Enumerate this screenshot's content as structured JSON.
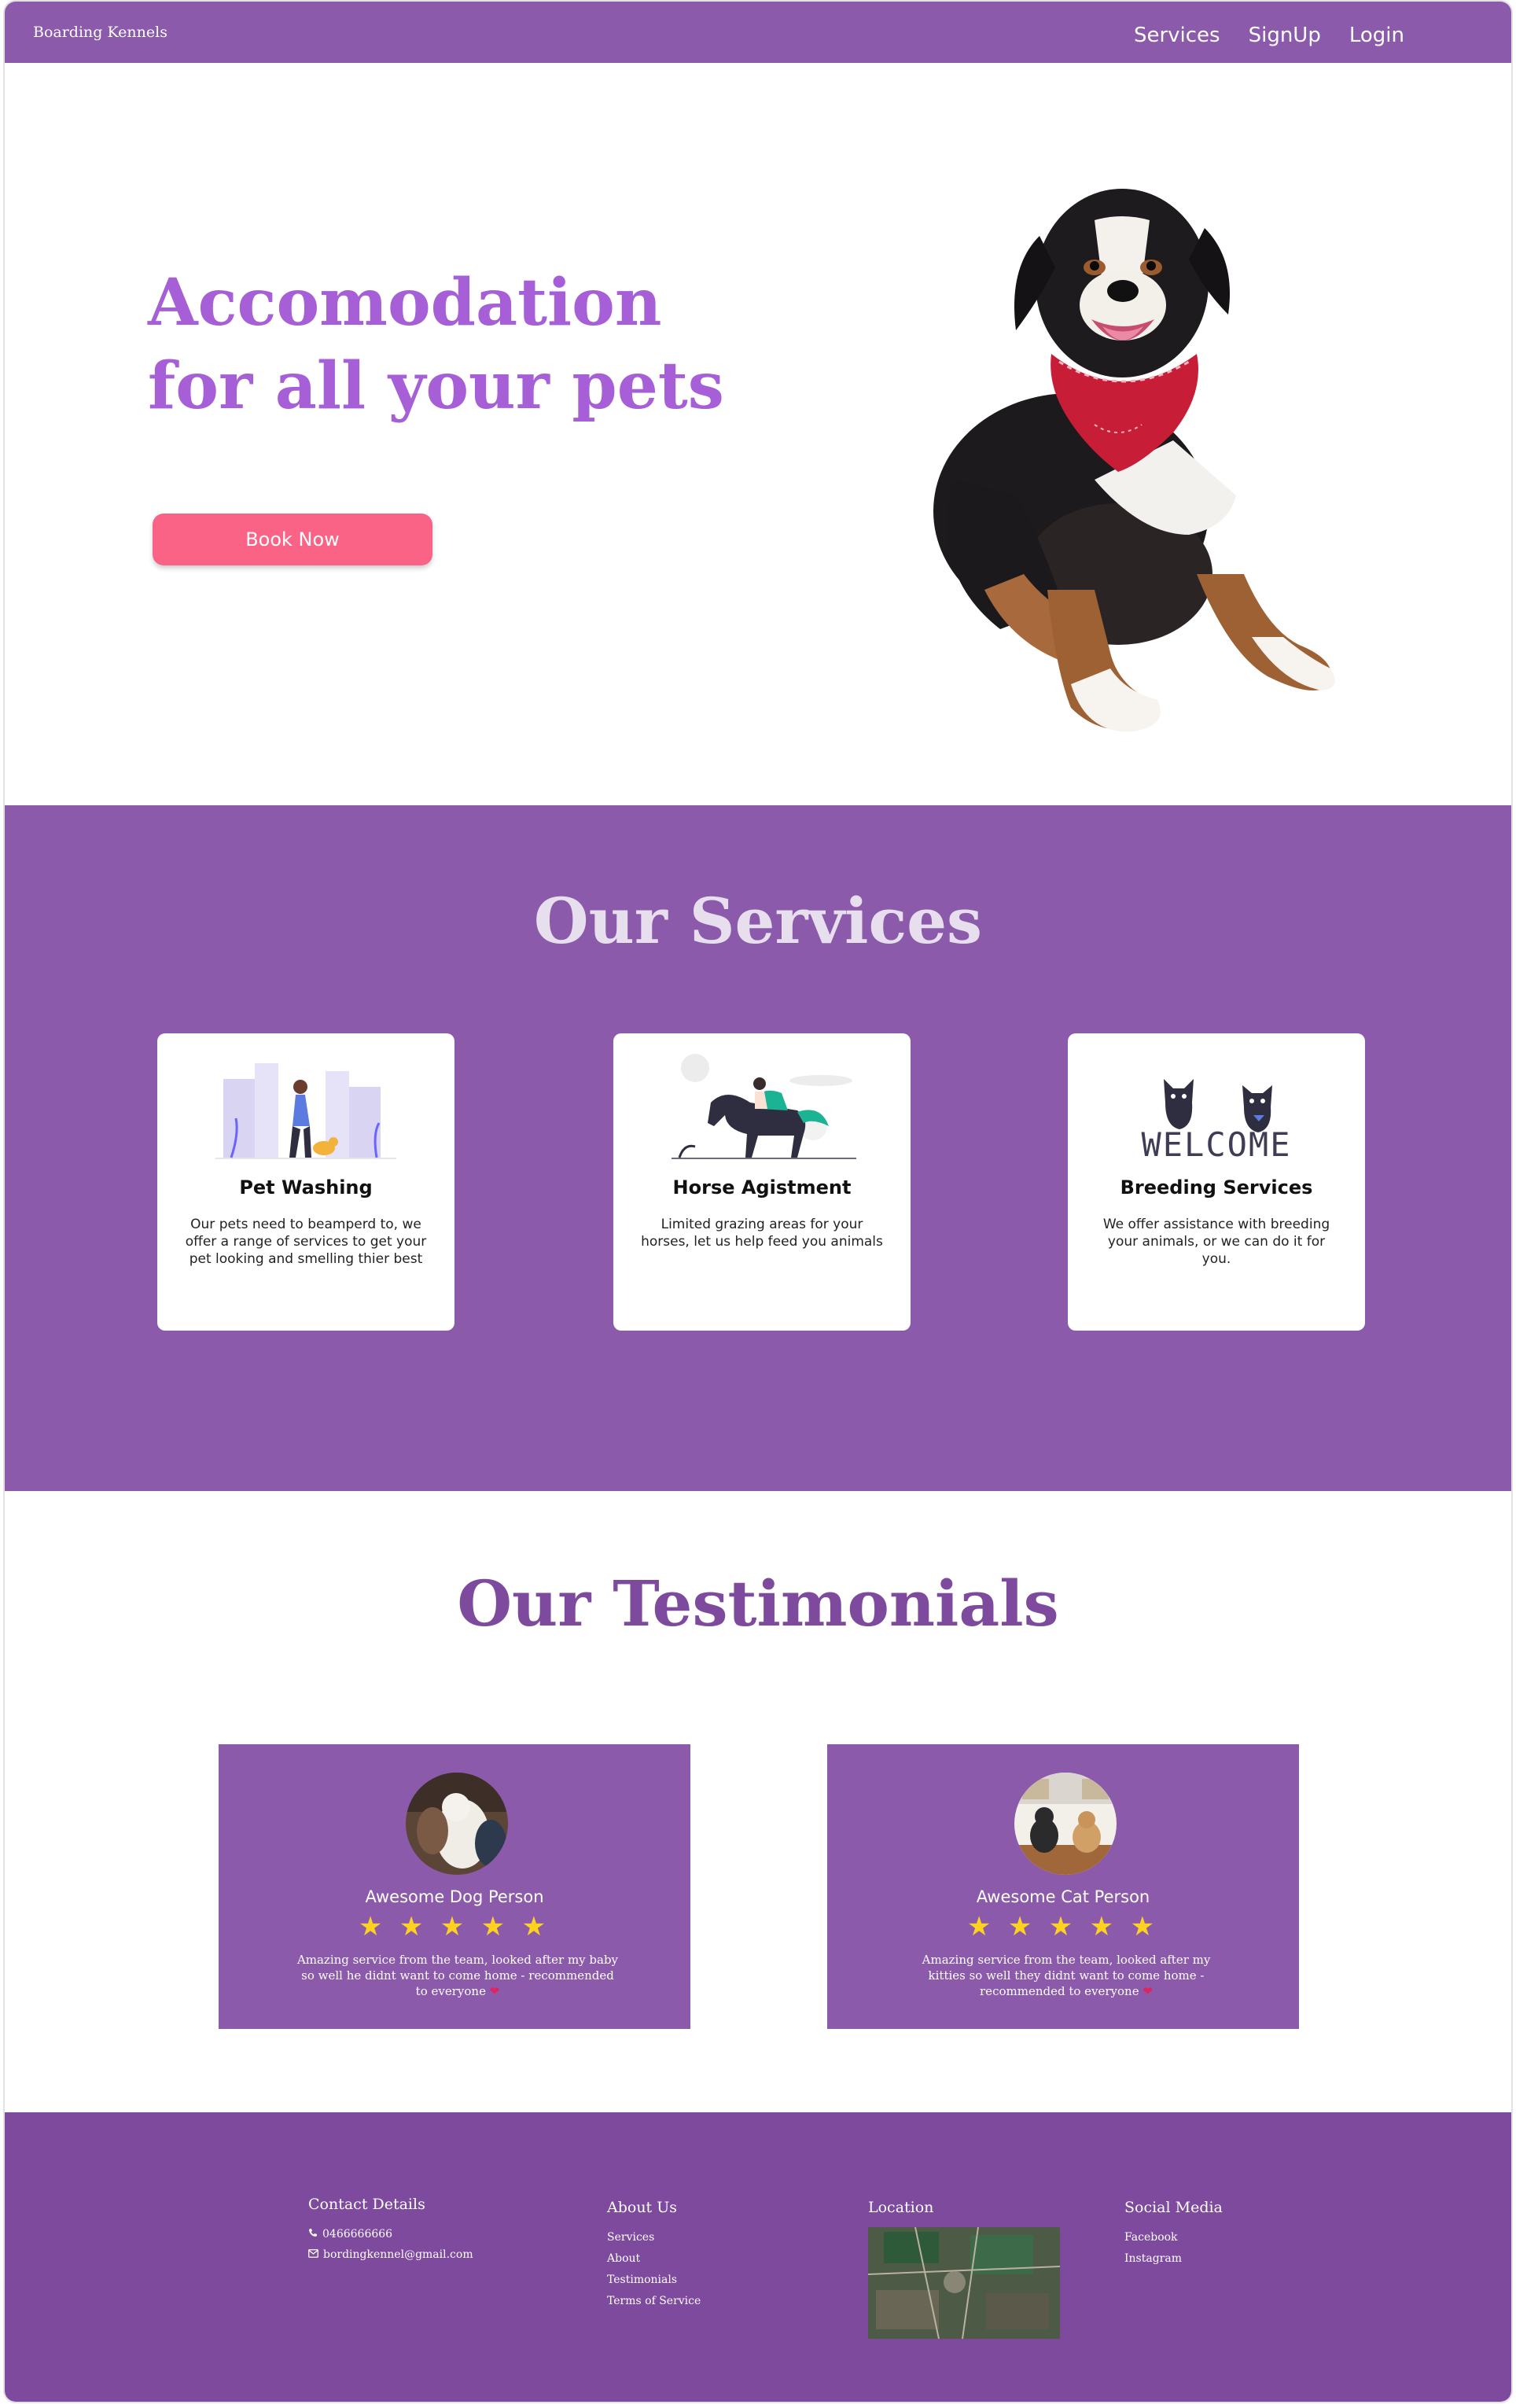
{
  "header": {
    "brand": "Boarding Kennels",
    "nav": [
      "Services",
      "SignUp",
      "Login"
    ]
  },
  "hero": {
    "title": "Accomodation for all your pets",
    "cta": "Book Now"
  },
  "services": {
    "title": "Our Services",
    "cards": [
      {
        "title": "Pet Washing",
        "text": "Our pets need to beamperd to, we offer a range of services to get your pet looking and smelling thier best"
      },
      {
        "title": "Horse Agistment",
        "text": "Limited grazing areas for your horses, let us help feed you animals"
      },
      {
        "title": "Breeding Services",
        "text": "We offer assistance with breeding your animals, or we can do it for you."
      }
    ],
    "welcome_text": "WELCOME"
  },
  "testimonials": {
    "title": "Our Testimonials",
    "items": [
      {
        "name": "Awesome Dog Person",
        "stars": "★ ★ ★ ★ ★",
        "rating": 5,
        "quote": "Amazing service from the team, looked after my baby so well he didnt want to come home - recommended to everyone"
      },
      {
        "name": "Awesome Cat Person",
        "stars": "★ ★ ★ ★ ★",
        "rating": 5,
        "quote": "Amazing service from the team, looked after my kitties so well they didnt want to come home - recommended to everyone"
      }
    ]
  },
  "footer": {
    "contact": {
      "heading": "Contact Details",
      "phone": "0466666666",
      "email": "bordingkennel@gmail.com"
    },
    "about": {
      "heading": "About Us",
      "links": [
        "Services",
        "About",
        "Testimonials",
        "Terms of Service"
      ]
    },
    "location": {
      "heading": "Location"
    },
    "social": {
      "heading": "Social Media",
      "links": [
        "Facebook",
        "Instagram"
      ]
    }
  },
  "colors": {
    "brand_purple": "#8b5aab",
    "footer_purple": "#7e4a9e",
    "cta_pink": "#fb6386",
    "hero_text": "#a65fd6",
    "star": "#ffd21f"
  }
}
